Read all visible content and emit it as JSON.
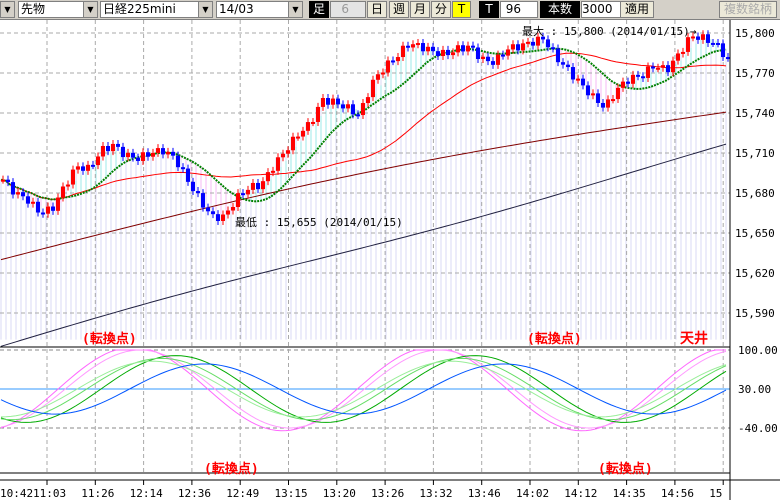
{
  "toolbar": {
    "market": "先物",
    "product": "日経225mini",
    "contract": "14/03",
    "ashi_label": "足",
    "ashi_value": "6",
    "day": "日",
    "week": "週",
    "month": "月",
    "minute": "分",
    "tick": "T",
    "t_label": "T",
    "t_value": "96",
    "count_label": "本数",
    "count_value": "3000",
    "apply": "適用",
    "multi": "複数銘柄"
  },
  "chart_data": {
    "type": "candlestick",
    "price_ticks": [
      "15,800",
      "15,770",
      "15,740",
      "15,710",
      "15,680",
      "15,650",
      "15,620",
      "15,590"
    ],
    "price_tick_values": [
      15800,
      15770,
      15740,
      15710,
      15680,
      15650,
      15620,
      15590
    ],
    "osc_ticks": [
      "100.00",
      "30.00",
      "-40.00"
    ],
    "osc_tick_values": [
      100,
      30,
      -40
    ],
    "time_labels": [
      "10:42",
      "11:03",
      "11:26",
      "12:14",
      "12:36",
      "12:49",
      "13:15",
      "13:20",
      "13:26",
      "13:32",
      "13:46",
      "14:02",
      "14:12",
      "14:35",
      "14:56",
      "15"
    ],
    "price_path": [
      15690,
      15680,
      15675,
      15665,
      15668,
      15685,
      15700,
      15698,
      15712,
      15716,
      15708,
      15706,
      15710,
      15712,
      15706,
      15690,
      15675,
      15662,
      15662,
      15676,
      15684,
      15686,
      15700,
      15712,
      15724,
      15732,
      15750,
      15748,
      15744,
      15738,
      15762,
      15774,
      15782,
      15792,
      15790,
      15786,
      15784,
      15788,
      15790,
      15780,
      15778,
      15788,
      15790,
      15793,
      15796,
      15782,
      15772,
      15762,
      15752,
      15744,
      15758,
      15766,
      15768,
      15776,
      15772,
      15784,
      15798,
      15796,
      15792,
      15780
    ],
    "max_label": "最大 : 15,800 (2014/01/15)→",
    "min_label": "最低 : 15,655 (2014/01/15)",
    "annotations": [
      "(転換点)",
      "(転換点)",
      "(転換点)",
      "(転換点)",
      "天井"
    ],
    "colors": {
      "up": "#ff0000",
      "down": "#0000ff",
      "ma_green": "#008000",
      "ma_red": "#ff0000",
      "ma_darkred": "#800000",
      "ma_navy": "#202040"
    }
  }
}
